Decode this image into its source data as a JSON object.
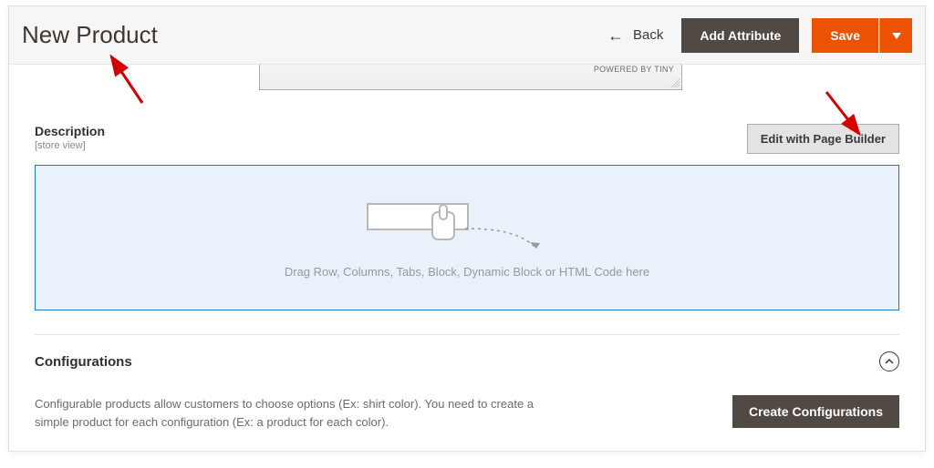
{
  "header": {
    "title": "New Product",
    "back_label": "Back",
    "add_attribute_label": "Add Attribute",
    "save_label": "Save"
  },
  "editor_strip": {
    "powered_by": "POWERED BY TINY"
  },
  "description": {
    "label": "Description",
    "scope": "[store view]",
    "edit_pb_label": "Edit with Page Builder",
    "drop_hint": "Drag Row, Columns, Tabs, Block, Dynamic Block or HTML Code here"
  },
  "configurations": {
    "title": "Configurations",
    "help_text": "Configurable products allow customers to choose options (Ex: shirt color). You need to create a simple product for each configuration (Ex: a product for each color).",
    "create_label": "Create Configurations"
  }
}
